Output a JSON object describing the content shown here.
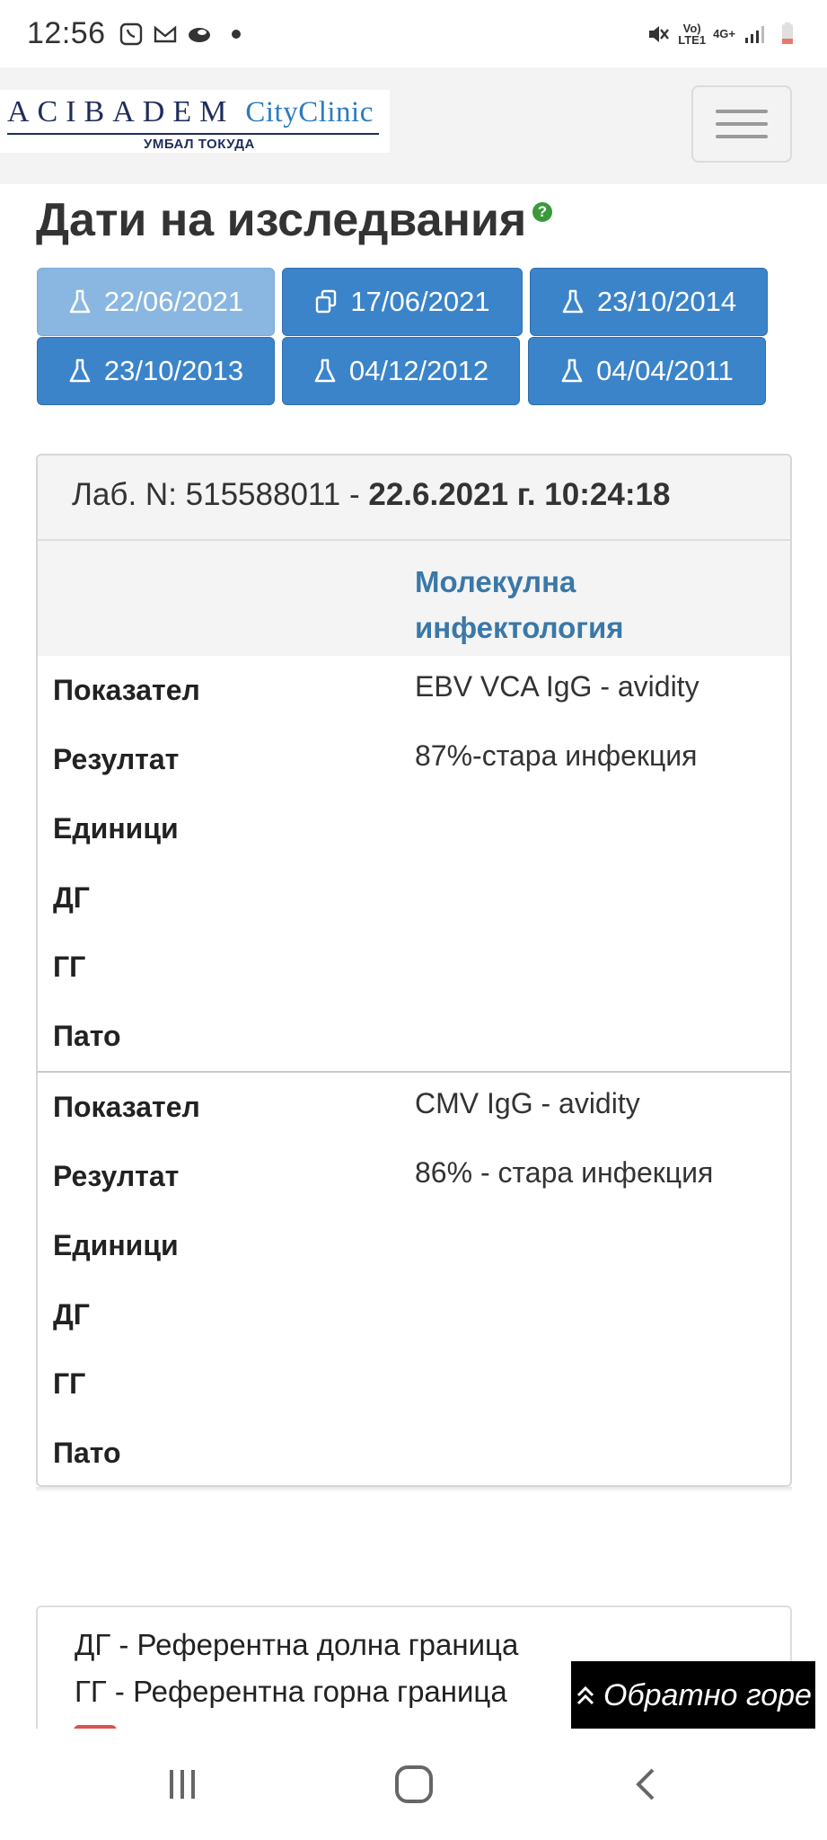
{
  "status_bar": {
    "time": "12:56",
    "network_top": "Vo)",
    "network_bottom": "LTE1",
    "network_type": "4G+"
  },
  "header": {
    "logo_brand": "ACIBADEM",
    "logo_city": "CityClinic",
    "logo_subtitle": "УМБАЛ ТОКУДА",
    "menu_icon": "hamburger-icon"
  },
  "dates": {
    "title": "Дати на изследвания",
    "help_icon": "?",
    "buttons": [
      {
        "label": "22/06/2021",
        "icon": "flask-icon",
        "active": true
      },
      {
        "label": "17/06/2021",
        "icon": "copy-icon",
        "active": false
      },
      {
        "label": "23/10/2014",
        "icon": "flask-icon",
        "active": false
      },
      {
        "label": "23/10/2013",
        "icon": "flask-icon",
        "active": false
      },
      {
        "label": "04/12/2012",
        "icon": "flask-icon",
        "active": false
      },
      {
        "label": "04/04/2011",
        "icon": "flask-icon",
        "active": false
      }
    ]
  },
  "lab": {
    "header_prefix": "Лаб. N: 515588011 - ",
    "header_datetime": "22.6.2021 г. 10:24:18",
    "category": "Молекулна инфектология",
    "results": [
      {
        "rows": [
          {
            "label": "Показател",
            "value": "EBV VCA IgG - avidity"
          },
          {
            "label": "Резултат",
            "value": "87%-стара инфекция"
          },
          {
            "label": "Единици",
            "value": ""
          },
          {
            "label": "ДГ",
            "value": ""
          },
          {
            "label": "ГГ",
            "value": ""
          },
          {
            "label": "Пато",
            "value": ""
          }
        ]
      },
      {
        "rows": [
          {
            "label": "Показател",
            "value": "CMV IgG - avidity"
          },
          {
            "label": "Резултат",
            "value": "86% - стара инфекция"
          },
          {
            "label": "Единици",
            "value": ""
          },
          {
            "label": "ДГ",
            "value": ""
          },
          {
            "label": "ГГ",
            "value": ""
          },
          {
            "label": "Пато",
            "value": ""
          }
        ]
      }
    ]
  },
  "legend": {
    "lines": [
      "ДГ - Референтна долна граница",
      "ГГ - Референтна горна граница"
    ]
  },
  "back_to_top": {
    "label": "Обратно горе"
  },
  "nav_bar": {
    "recents_icon": "recents-icon",
    "home_icon": "home-icon",
    "back_icon": "back-icon"
  },
  "colors": {
    "button_blue": "#3b84c9",
    "button_active": "#89b7e1",
    "category_blue": "#3a78a8",
    "help_green": "#3a9a3a"
  }
}
